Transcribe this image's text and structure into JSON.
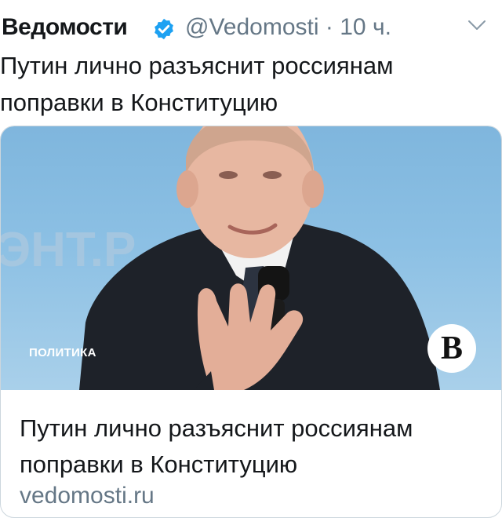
{
  "tweet": {
    "author_name": "Ведомости",
    "handle": "@Vedomosti",
    "separator": "·",
    "time": "10 ч.",
    "text": "Путин лично разъяснит россиянам поправки в Конституцию"
  },
  "card": {
    "category": "ПОЛИТИКА",
    "logo_letter": "В",
    "background_text": "ЭНТ.Р",
    "title": "Путин лично разъяснит россиянам поправки в Конституцию",
    "domain": "vedomosti.ru"
  },
  "colors": {
    "text": "#14171a",
    "secondary": "#657786",
    "verified": "#1da1f2",
    "border": "#ccd6dd"
  },
  "icons": [
    "verified-badge-icon",
    "chevron-down-icon"
  ]
}
